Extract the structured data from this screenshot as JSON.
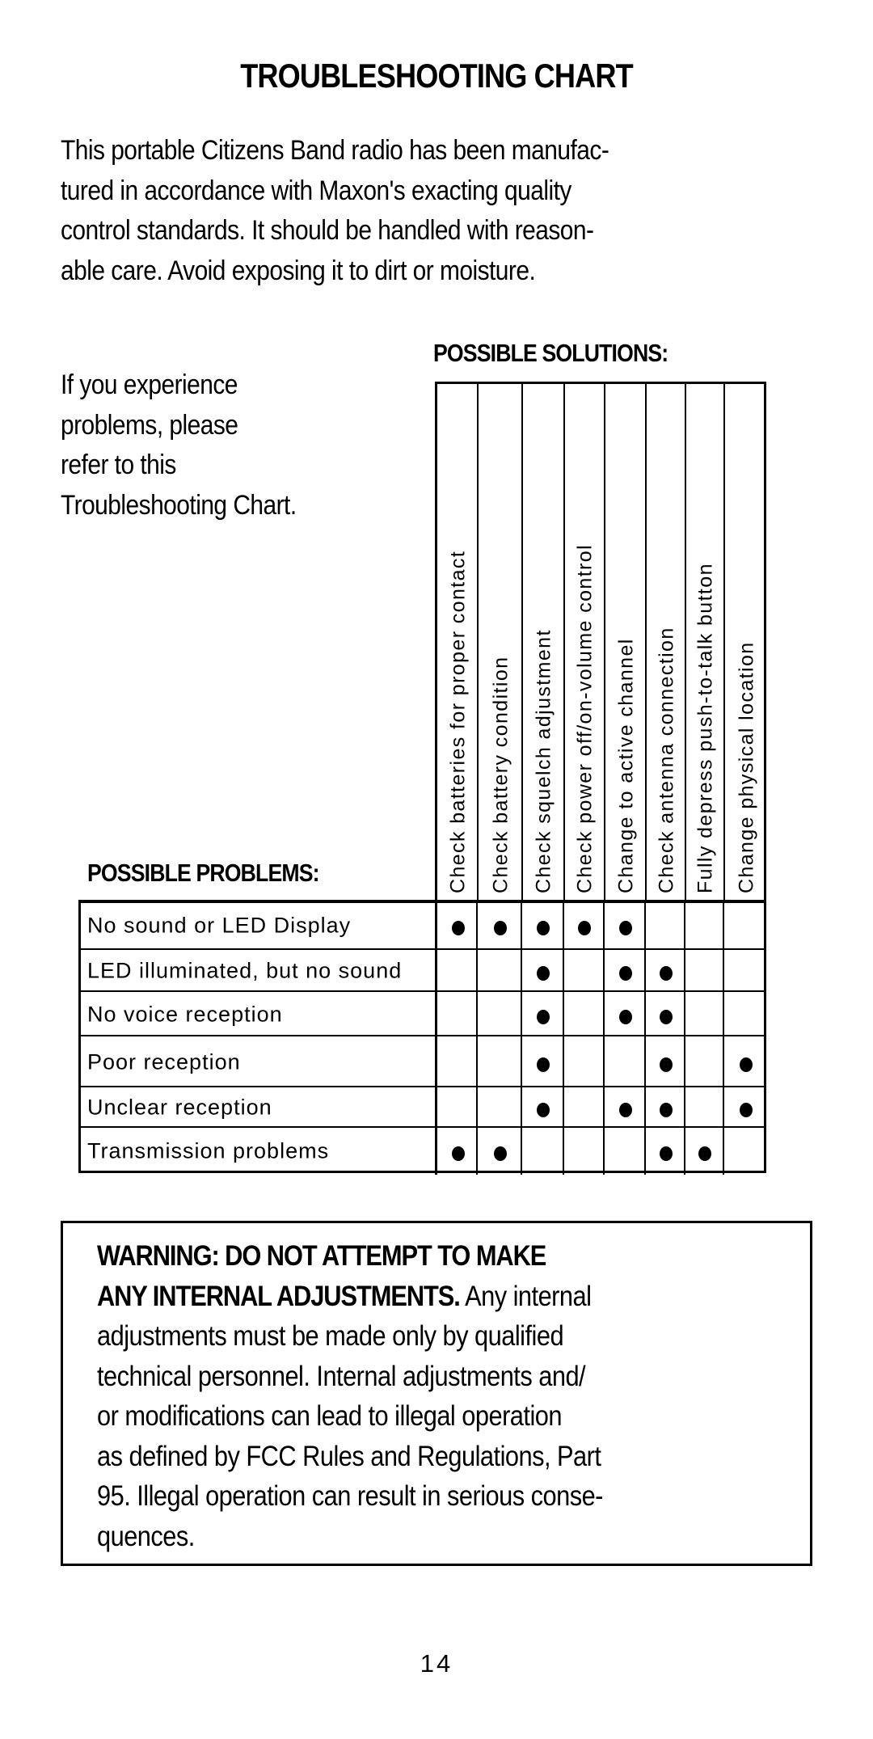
{
  "page": {
    "title": "TROUBLESHOOTING CHART",
    "intro_lines": [
      "This portable Citizens Band radio has been manufac-",
      "tured in accordance with Maxon's exacting quality",
      "control standards. It should be handled with reason-",
      "able care. Avoid exposing it to dirt or moisture."
    ],
    "side_note_lines": [
      "If you experience",
      "problems, please",
      "refer to this",
      "Troubleshooting Chart."
    ],
    "solutions_label": "POSSIBLE SOLUTIONS:",
    "problems_label": "POSSIBLE PROBLEMS:",
    "page_number": "14"
  },
  "chart_data": {
    "type": "table",
    "title": "TROUBLESHOOTING CHART",
    "columns": [
      "Check batteries for proper contact",
      "Check battery condition",
      "Check squelch adjustment",
      "Check power off/on-volume control",
      "Change to active channel",
      "Check antenna connection",
      "Fully depress push-to-talk button",
      "Change physical location"
    ],
    "rows": [
      {
        "problem": "No sound or LED Display",
        "marks": [
          1,
          1,
          1,
          1,
          1,
          0,
          0,
          0
        ]
      },
      {
        "problem": "LED illuminated, but no sound",
        "marks": [
          0,
          0,
          1,
          0,
          1,
          1,
          0,
          0
        ]
      },
      {
        "problem": "No voice reception",
        "marks": [
          0,
          0,
          1,
          0,
          1,
          1,
          0,
          0
        ]
      },
      {
        "problem": "Poor reception",
        "marks": [
          0,
          0,
          1,
          0,
          0,
          1,
          0,
          1
        ]
      },
      {
        "problem": "Unclear reception",
        "marks": [
          0,
          0,
          1,
          0,
          1,
          1,
          0,
          1
        ]
      },
      {
        "problem": "Transmission problems",
        "marks": [
          1,
          1,
          0,
          0,
          0,
          1,
          1,
          0
        ]
      }
    ],
    "mark_symbol": "filled-dot"
  },
  "warning": {
    "bold_lines": [
      "WARNING: DO NOT ATTEMPT TO MAKE",
      "ANY INTERNAL ADJUSTMENTS."
    ],
    "line2_rest": " Any internal",
    "body_lines": [
      "adjustments must be made only by qualified",
      "technical personnel. Internal adjustments and/",
      "or modifications can lead to illegal operation",
      "as defined by FCC Rules and Regulations, Part",
      "95. Illegal operation can result in serious conse-",
      "quences."
    ]
  }
}
